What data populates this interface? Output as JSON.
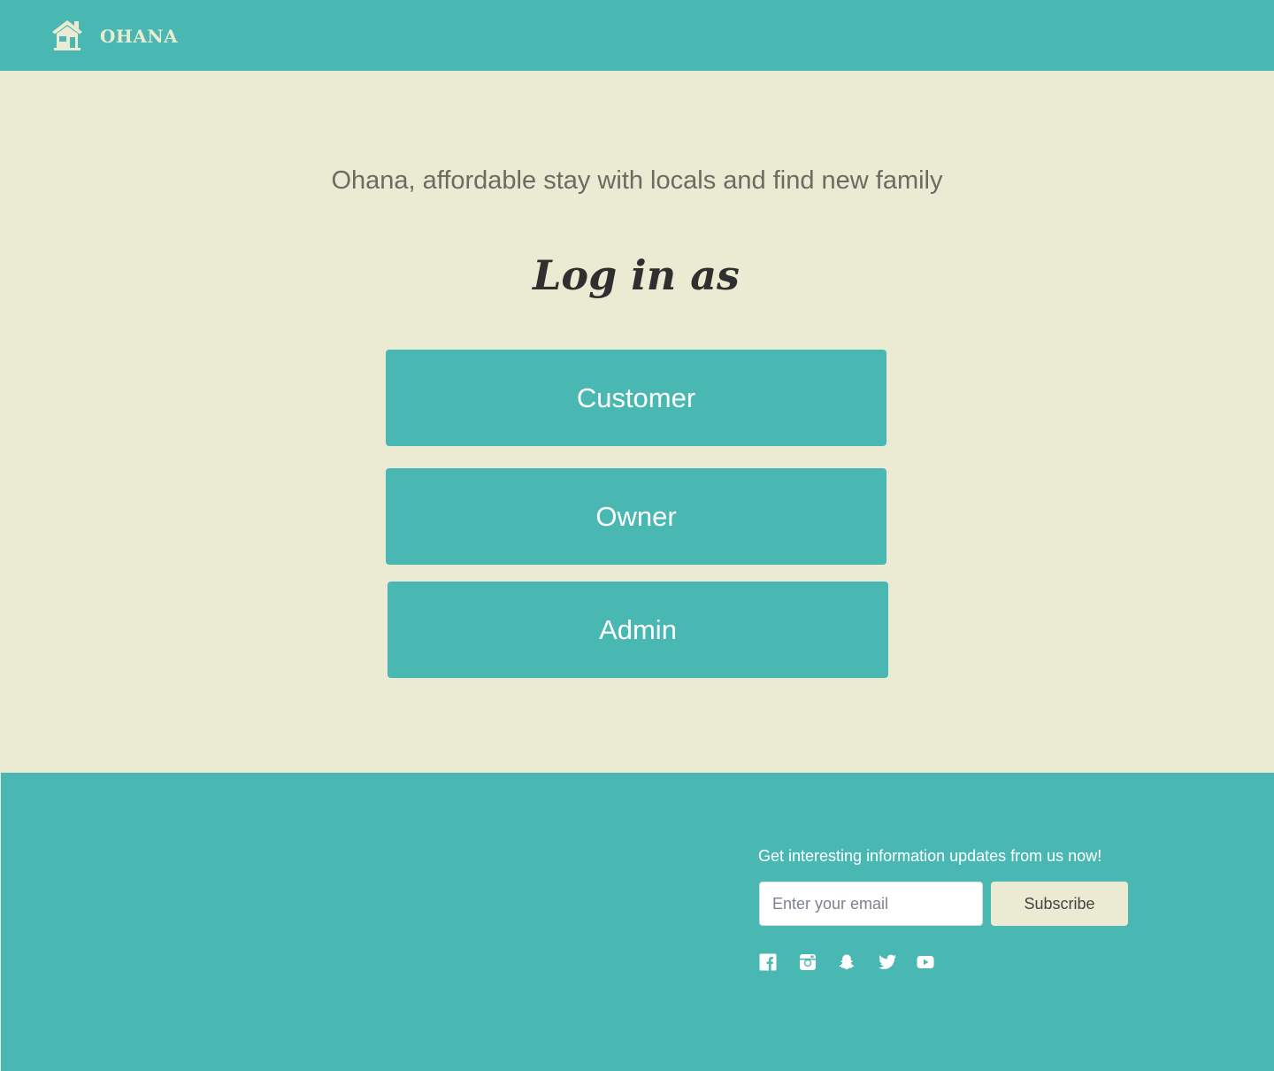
{
  "header": {
    "brand": "OHANA",
    "logo_icon": "house-icon"
  },
  "hero": {
    "tagline": "Ohana, affordable stay with locals and find new family",
    "title": "Log in as"
  },
  "roles": {
    "customer": "Customer",
    "owner": "Owner",
    "admin": "Admin"
  },
  "footer": {
    "newsletter_text": "Get interesting information updates from us now!",
    "email_placeholder": "Enter your email",
    "subscribe_label": "Subscribe",
    "social_icons": [
      "facebook-icon",
      "instagram-icon",
      "snapchat-icon",
      "twitter-icon",
      "youtube-icon"
    ]
  },
  "colors": {
    "primary": "#4AB8B2",
    "background": "#EBEBD3",
    "title": "#2F2F2F"
  }
}
